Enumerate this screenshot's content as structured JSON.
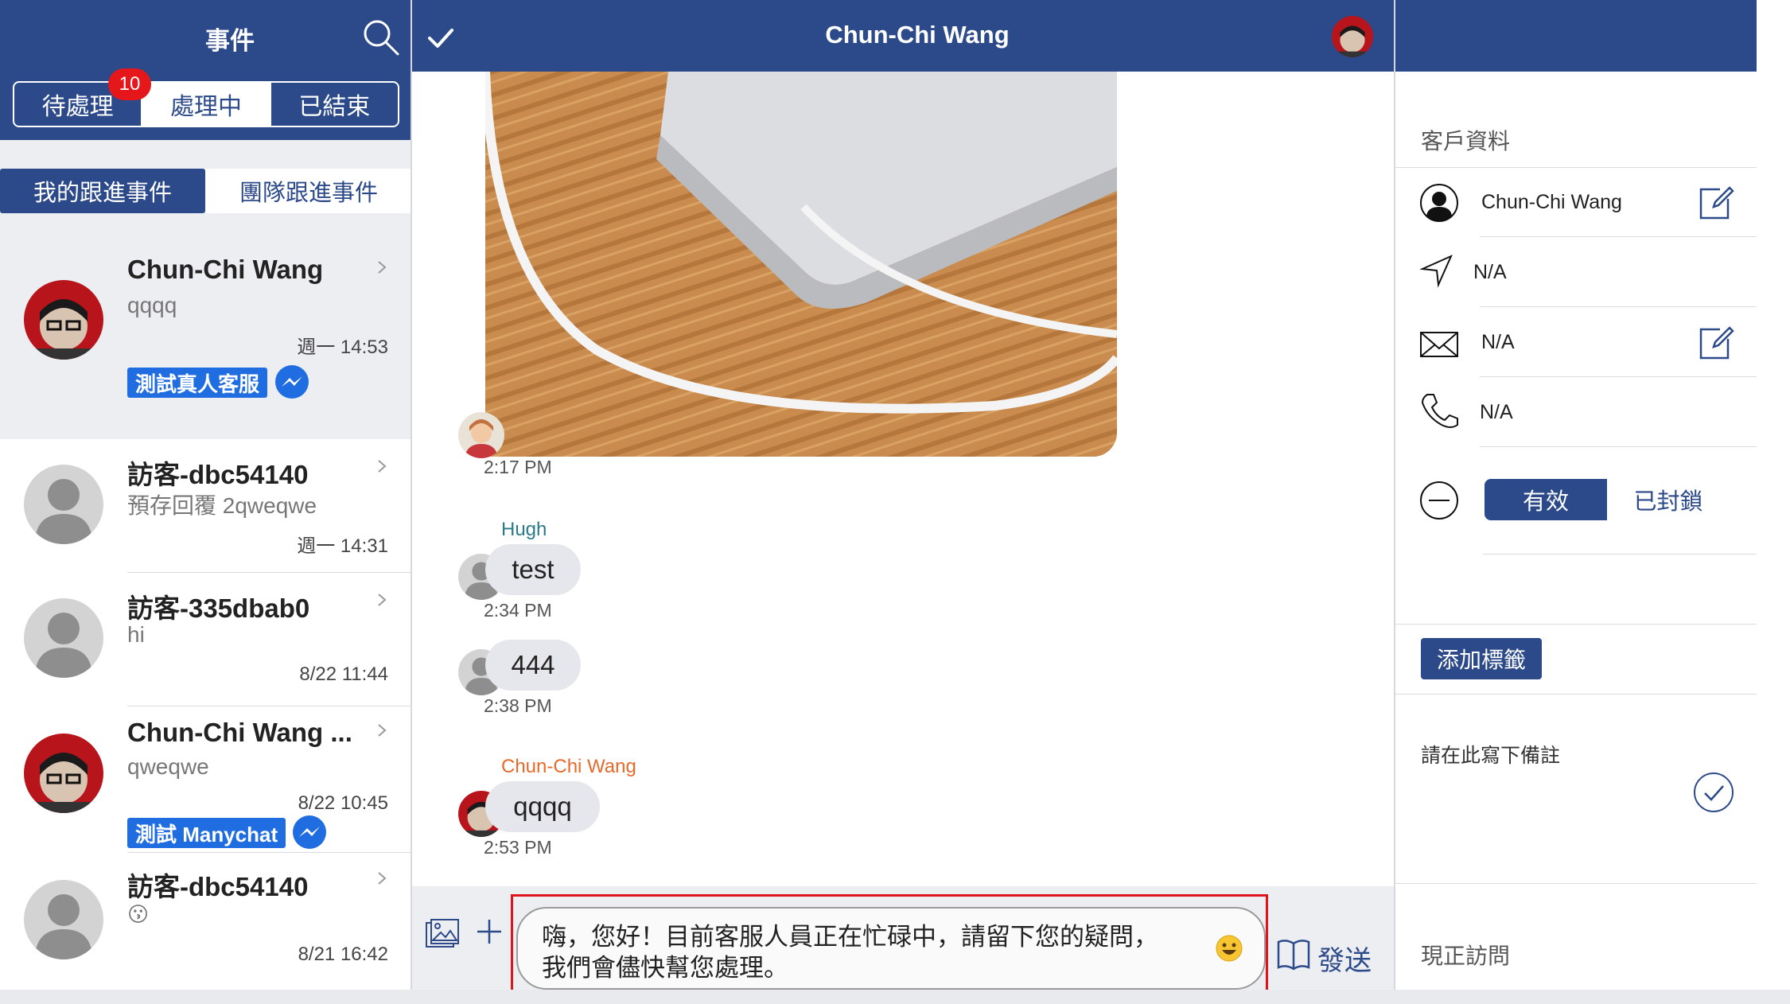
{
  "left_panel": {
    "title": "事件",
    "status_tabs": [
      "待處理",
      "處理中",
      "已結束"
    ],
    "pending_badge": "10",
    "scope_tabs": [
      "我的跟進事件",
      "團隊跟進事件"
    ],
    "conversations": [
      {
        "name": "Chun-Chi Wang",
        "preview": "qqqq",
        "time": "週一 14:53",
        "tag": "測試真人客服",
        "channel_icon": "messenger-icon",
        "selected": true
      },
      {
        "name": "訪客-dbc54140",
        "preview": "預存回覆 2qweqwe",
        "time": "週一 14:31"
      },
      {
        "name": "訪客-335dbab0",
        "preview": "hi",
        "time": "8/22 11:44"
      },
      {
        "name": "Chun-Chi Wang ...",
        "preview": "qweqwe",
        "time": "8/22 10:45",
        "tag": "測試 Manychat",
        "channel_icon": "messenger-icon"
      },
      {
        "name": "訪客-dbc54140",
        "preview": "😗",
        "time": "8/21 16:42"
      }
    ]
  },
  "chat": {
    "title": "Chun-Chi Wang",
    "messages": [
      {
        "type": "image",
        "time": "2:17 PM"
      },
      {
        "sender": "Hugh",
        "text": "test",
        "time": "2:34 PM"
      },
      {
        "text": "444",
        "time": "2:38 PM"
      },
      {
        "sender": "Chun-Chi Wang",
        "text": "qqqq",
        "time": "2:53 PM"
      }
    ],
    "composer_text": "嗨，您好！目前客服人員正在忙碌中，請留下您的疑問，\n我們會儘快幫您處理。",
    "send_label": "發送"
  },
  "right_panel": {
    "section_title": "客戶資料",
    "customer_name": "Chun-Chi Wang",
    "location": "N/A",
    "email": "N/A",
    "phone": "N/A",
    "status_valid": "有效",
    "status_blocked": "已封鎖",
    "add_tag_label": "添加標籤",
    "note_placeholder": "請在此寫下備註",
    "current_visit_title": "現正訪問"
  },
  "colors": {
    "primary": "#2c4a8a",
    "badge": "#e5171b",
    "tag": "#1f6de0",
    "highlight_border": "#e0151c",
    "sender_hugh": "#2a7a8a",
    "sender_customer": "#e86a2a"
  }
}
